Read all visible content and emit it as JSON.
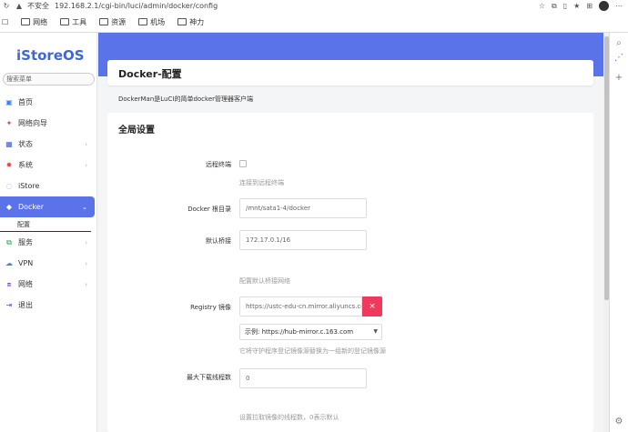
{
  "browser": {
    "security": "不安全",
    "url": "192.168.2.1/cgi-bin/luci/admin/docker/config",
    "bookmarks": [
      "网络",
      "工具",
      "资源",
      "机场",
      "神力"
    ]
  },
  "sidebar": {
    "logo": "iStoreOS",
    "search_placeholder": "搜索菜单",
    "items": [
      {
        "label": "首页",
        "icon": "home-icon",
        "color": "#3b82f6"
      },
      {
        "label": "网络向导",
        "icon": "wizard-icon",
        "color": "#ef4444"
      },
      {
        "label": "状态",
        "icon": "status-icon",
        "color": "#3b5bdb"
      },
      {
        "label": "系统",
        "icon": "gear-icon",
        "color": "#ef4444"
      },
      {
        "label": "iStore",
        "icon": "store-icon",
        "color": "#8aa0ff"
      },
      {
        "label": "Docker",
        "icon": "docker-icon",
        "color": "#ffffff"
      },
      {
        "label": "服务",
        "icon": "service-icon",
        "color": "#16a34a"
      },
      {
        "label": "VPN",
        "icon": "vpn-icon",
        "color": "#3b82f6"
      },
      {
        "label": "网络",
        "icon": "network-icon",
        "color": "#7c3aed"
      },
      {
        "label": "退出",
        "icon": "logout-icon",
        "color": "#3b5bdb"
      }
    ],
    "sub_item": "配置"
  },
  "page": {
    "title": "Docker-配置",
    "description": "DockerMan是LuCI的简单docker管理器客户端",
    "section_title": "全局设置"
  },
  "form": {
    "remote_terminal_label": "远程终端",
    "remote_terminal_hint": "连接到远程终端",
    "root_dir_label": "Docker 根目录",
    "root_dir_value": "/mnt/sata1-4/docker",
    "default_bridge_label": "默认桥接",
    "default_bridge_value": "172.17.0.1/16",
    "default_bridge_hint": "配置默认桥接网络",
    "registry_label": "Registry 镜像",
    "registry_value": "https://ustc-edu-cn.mirror.aliyuncs.com",
    "registry_delete": "×",
    "registry_select": "示例: https://hub-mirror.c.163.com",
    "registry_hint": "它将守护程序登记镜像源替换为一组新的登记镜像源",
    "max_download_label": "最大下载线程数",
    "max_download_value": "0",
    "max_download_hint": "设置拉取镜像的线程数，0表示默认"
  }
}
